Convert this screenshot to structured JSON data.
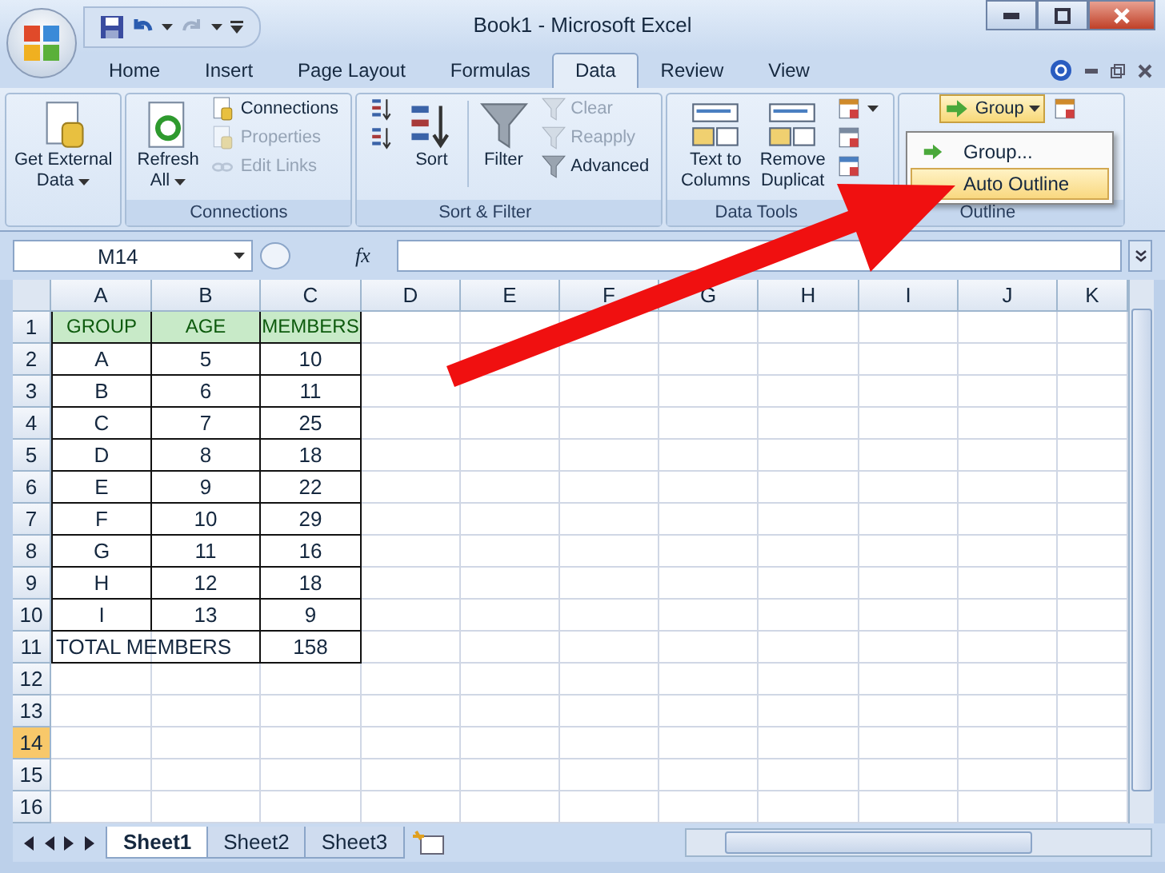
{
  "window": {
    "title": "Book1 - Microsoft Excel"
  },
  "tabs": [
    {
      "label": "Home",
      "selected": false
    },
    {
      "label": "Insert",
      "selected": false
    },
    {
      "label": "Page Layout",
      "selected": false
    },
    {
      "label": "Formulas",
      "selected": false
    },
    {
      "label": "Data",
      "selected": true
    },
    {
      "label": "Review",
      "selected": false
    },
    {
      "label": "View",
      "selected": false
    }
  ],
  "ribbon": {
    "groups": [
      {
        "items": [
          {
            "kind": "large",
            "label": "Get External\nData",
            "menu": true,
            "enabled": true
          }
        ]
      },
      {
        "label": "Connections",
        "items": [
          {
            "kind": "large",
            "label": "Refresh\nAll",
            "menu": true,
            "enabled": true
          },
          {
            "kind": "stack",
            "items": [
              {
                "label": "Connections",
                "enabled": true
              },
              {
                "label": "Properties",
                "enabled": false
              },
              {
                "label": "Edit Links",
                "enabled": false
              }
            ]
          }
        ]
      },
      {
        "label": "Sort & Filter",
        "items": [
          {
            "kind": "stack",
            "items": [
              {
                "enabled": true
              },
              {
                "enabled": true
              }
            ]
          },
          {
            "kind": "large",
            "label": "Sort",
            "enabled": true
          },
          {
            "kind": "separator"
          },
          {
            "kind": "large",
            "label": "Filter",
            "enabled": true
          },
          {
            "kind": "stack",
            "items": [
              {
                "label": "Clear",
                "enabled": false
              },
              {
                "label": "Reapply",
                "enabled": false
              },
              {
                "label": "Advanced",
                "enabled": true
              }
            ]
          }
        ]
      },
      {
        "label": "Data Tools",
        "items": [
          {
            "kind": "large",
            "label": "Text to\nColumns",
            "enabled": true
          },
          {
            "kind": "large",
            "label": "Remove\nDuplicat",
            "enabled": true
          },
          {
            "kind": "stack",
            "items": [
              {
                "enabled": true,
                "menu": true
              },
              {
                "enabled": true
              },
              {
                "enabled": true
              }
            ]
          }
        ]
      },
      {
        "label": "Outline",
        "items": [
          {
            "kind": "stack",
            "items": [
              {
                "label": "Group",
                "enabled": true,
                "menu": true,
                "pressed": true
              }
            ]
          },
          {
            "kind": "stack",
            "items": [
              {
                "enabled": true
              }
            ]
          }
        ]
      }
    ]
  },
  "menu": {
    "items": [
      {
        "label": "Group...",
        "selected": false
      },
      {
        "label": "Auto Outline",
        "selected": true
      }
    ]
  },
  "formula_bar": {
    "name_box": "M14",
    "function_label": "fx"
  },
  "grid": {
    "columns": [
      "A",
      "B",
      "C",
      "D",
      "E",
      "F",
      "G",
      "H",
      "I",
      "J",
      "K"
    ],
    "rows": [
      {
        "number": "1",
        "selected": false,
        "kind": "header",
        "cells": [
          "GROUP",
          "AGE",
          "MEMBERS"
        ]
      },
      {
        "number": "2",
        "selected": false,
        "kind": "data",
        "cells": [
          "A",
          "5",
          "10"
        ]
      },
      {
        "number": "3",
        "selected": false,
        "kind": "data",
        "cells": [
          "B",
          "6",
          "11"
        ]
      },
      {
        "number": "4",
        "selected": false,
        "kind": "data",
        "cells": [
          "C",
          "7",
          "25"
        ]
      },
      {
        "number": "5",
        "selected": false,
        "kind": "data",
        "cells": [
          "D",
          "8",
          "18"
        ]
      },
      {
        "number": "6",
        "selected": false,
        "kind": "data",
        "cells": [
          "E",
          "9",
          "22"
        ]
      },
      {
        "number": "7",
        "selected": false,
        "kind": "data",
        "cells": [
          "F",
          "10",
          "29"
        ]
      },
      {
        "number": "8",
        "selected": false,
        "kind": "data",
        "cells": [
          "G",
          "11",
          "16"
        ]
      },
      {
        "number": "9",
        "selected": false,
        "kind": "data",
        "cells": [
          "H",
          "12",
          "18"
        ]
      },
      {
        "number": "10",
        "selected": false,
        "kind": "data",
        "cells": [
          "I",
          "13",
          "9"
        ]
      },
      {
        "number": "11",
        "selected": false,
        "kind": "total",
        "cells": [
          "TOTAL MEMBERS",
          "158"
        ]
      },
      {
        "number": "12",
        "selected": false,
        "kind": "empty"
      },
      {
        "number": "13",
        "selected": false,
        "kind": "empty"
      },
      {
        "number": "14",
        "selected": true,
        "kind": "empty"
      },
      {
        "number": "15",
        "selected": false,
        "kind": "empty"
      },
      {
        "number": "16",
        "selected": false,
        "kind": "empty"
      }
    ]
  },
  "sheet_tabs": [
    {
      "label": "Sheet1",
      "selected": true
    },
    {
      "label": "Sheet2",
      "selected": false
    },
    {
      "label": "Sheet3",
      "selected": false
    }
  ]
}
